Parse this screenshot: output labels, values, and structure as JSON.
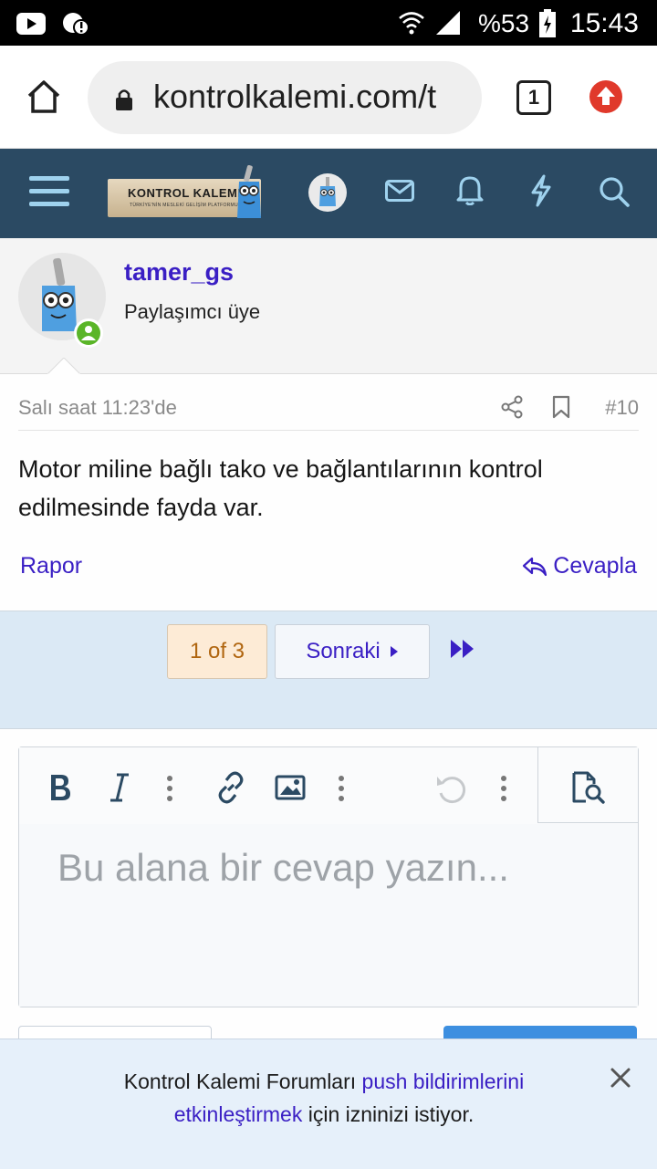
{
  "status_bar": {
    "battery": "%53",
    "time": "15:43"
  },
  "browser": {
    "url": "kontrolkalemi.com/t",
    "tab_count": "1"
  },
  "forum_header": {
    "logo_title": "KONTROL KALEMI",
    "logo_subtitle": "TÜRKİYE'NİN MESLEKİ GELİŞİM PLATFORMU",
    "colors": {
      "bar": "#2b4a63",
      "icons": "#9fd2ee"
    }
  },
  "post": {
    "author": "tamer_gs",
    "user_title": "Paylaşımcı üye",
    "date": "Salı saat 11:23'de",
    "number": "#10",
    "body": "Motor miline bağlı tako ve bağlantılarının kontrol edilmesinde fayda var.",
    "report_label": "Rapor",
    "reply_label": "Cevapla"
  },
  "pagination": {
    "current": "1 of 3",
    "next_label": "Sonraki"
  },
  "editor": {
    "placeholder": "Bu alana bir cevap yazın..."
  },
  "push_notice": {
    "text_before": "Kontrol Kalemi Forumları",
    "link_text_1": "push bildirimlerini",
    "link_text_2": "etkinleştirmek",
    "text_after": "için izninizi istiyor."
  },
  "colors": {
    "link": "#3a1fc4",
    "online_badge": "#5ab528",
    "page_band": "#dbe9f5"
  }
}
